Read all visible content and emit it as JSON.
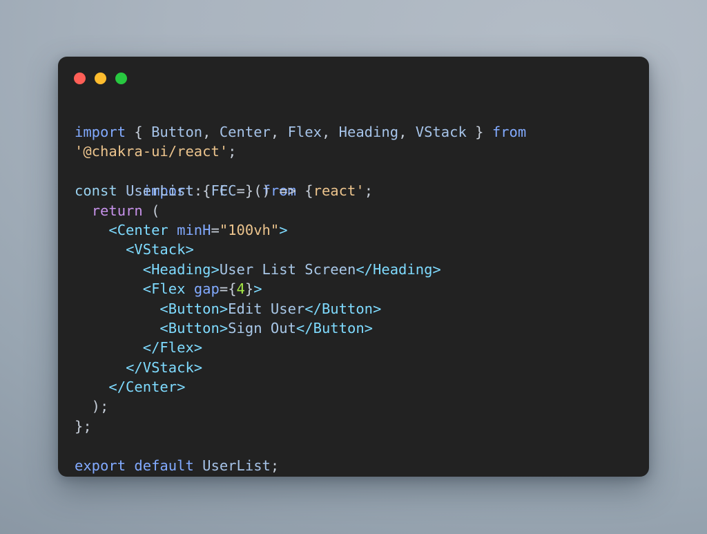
{
  "window": {
    "title_dots": [
      {
        "name": "close-dot",
        "color": "#ff5f57"
      },
      {
        "name": "minimize-dot",
        "color": "#febc2e"
      },
      {
        "name": "maximize-dot",
        "color": "#28c840"
      }
    ]
  },
  "theme": {
    "page_background": "#aab4bf",
    "window_background": "#222222",
    "keyword": "#c792ea",
    "import": "#82aaff",
    "tag": "#7fdbff",
    "string": "#ecc48d",
    "number": "#a5e844",
    "plain": "#d6deeb"
  },
  "code": {
    "language": "tsx",
    "full_source": "import { Button, Center, Flex, Heading, VStack } from '@chakra-ui/react';\nimport { FC } from 'react';\n\nconst UserList: FC = () => {\n  return (\n    <Center minH=\"100vh\">\n      <VStack>\n        <Heading>User List Screen</Heading>\n        <Flex gap={4}>\n          <Button>Edit User</Button>\n          <Button>Sign Out</Button>\n        </Flex>\n      </VStack>\n    </Center>\n  );\n};\n\nexport default UserList;",
    "lines": [
      {
        "id": "line-1",
        "text": "import { Button, Center, Flex, Heading, VStack } from"
      },
      {
        "id": "line-2",
        "text": "import { FC } from 'react';",
        "overlay_text": "'@chakra-ui/react';"
      },
      {
        "id": "line-3",
        "text": ""
      },
      {
        "id": "line-4",
        "text": "const UserList: FC = () => {"
      },
      {
        "id": "line-5",
        "text": "  return ("
      },
      {
        "id": "line-6",
        "text": "    <Center minH=\"100vh\">"
      },
      {
        "id": "line-7",
        "text": "      <VStack>"
      },
      {
        "id": "line-8",
        "text": "        <Heading>User List Screen</Heading>"
      },
      {
        "id": "line-9",
        "text": "        <Flex gap={4}>"
      },
      {
        "id": "line-10",
        "text": "          <Button>Edit User</Button>"
      },
      {
        "id": "line-11",
        "text": "          <Button>Sign Out</Button>"
      },
      {
        "id": "line-12",
        "text": "        </Flex>"
      },
      {
        "id": "line-13",
        "text": "      </VStack>"
      },
      {
        "id": "line-14",
        "text": "    </Center>"
      },
      {
        "id": "line-15",
        "text": "  );"
      },
      {
        "id": "line-16",
        "text": "};"
      },
      {
        "id": "line-17",
        "text": ""
      },
      {
        "id": "line-18",
        "text": "export default UserList;"
      }
    ],
    "tokens": {
      "l1": [
        {
          "t": "import",
          "c": "t-import"
        },
        {
          "t": " { ",
          "c": "t-punct"
        },
        {
          "t": "Button",
          "c": "t-ident"
        },
        {
          "t": ", ",
          "c": "t-punct"
        },
        {
          "t": "Center",
          "c": "t-ident"
        },
        {
          "t": ", ",
          "c": "t-punct"
        },
        {
          "t": "Flex",
          "c": "t-ident"
        },
        {
          "t": ", ",
          "c": "t-punct"
        },
        {
          "t": "Heading",
          "c": "t-ident"
        },
        {
          "t": ", ",
          "c": "t-punct"
        },
        {
          "t": "VStack",
          "c": "t-ident"
        },
        {
          "t": " } ",
          "c": "t-punct"
        },
        {
          "t": "from",
          "c": "t-import"
        }
      ],
      "l2": [
        {
          "t": "import",
          "c": "t-import"
        },
        {
          "t": " { ",
          "c": "t-punct"
        },
        {
          "t": "FC",
          "c": "t-ident"
        },
        {
          "t": " } ",
          "c": "t-punct"
        },
        {
          "t": "from",
          "c": "t-import"
        },
        {
          "t": " ",
          "c": "t-punct"
        },
        {
          "t": "'react'",
          "c": "t-string"
        },
        {
          "t": ";",
          "c": "t-punct"
        }
      ],
      "l2_overlay": [
        {
          "t": "'@chakra-ui/react'",
          "c": "t-string"
        },
        {
          "t": ";",
          "c": "t-punct"
        }
      ],
      "l4": [
        {
          "t": "const",
          "c": "t-const"
        },
        {
          "t": " ",
          "c": "t-punct"
        },
        {
          "t": "UserList",
          "c": "t-ident"
        },
        {
          "t": ": ",
          "c": "t-punct"
        },
        {
          "t": "FC",
          "c": "t-ident"
        },
        {
          "t": " = () => {",
          "c": "t-punct"
        }
      ],
      "l5": [
        {
          "t": "  ",
          "c": "t-punct"
        },
        {
          "t": "return",
          "c": "t-keyword"
        },
        {
          "t": " (",
          "c": "t-punct"
        }
      ],
      "l6": [
        {
          "t": "    ",
          "c": "t-punct"
        },
        {
          "t": "<Center",
          "c": "t-tag"
        },
        {
          "t": " ",
          "c": "t-punct"
        },
        {
          "t": "minH",
          "c": "t-attr"
        },
        {
          "t": "=",
          "c": "t-punct"
        },
        {
          "t": "\"100vh\"",
          "c": "t-string"
        },
        {
          "t": ">",
          "c": "t-tag"
        }
      ],
      "l7": [
        {
          "t": "      ",
          "c": "t-punct"
        },
        {
          "t": "<VStack>",
          "c": "t-tag"
        }
      ],
      "l8": [
        {
          "t": "        ",
          "c": "t-punct"
        },
        {
          "t": "<Heading>",
          "c": "t-tag"
        },
        {
          "t": "User List Screen",
          "c": "t-text"
        },
        {
          "t": "</Heading>",
          "c": "t-tag"
        }
      ],
      "l9": [
        {
          "t": "        ",
          "c": "t-punct"
        },
        {
          "t": "<Flex",
          "c": "t-tag"
        },
        {
          "t": " ",
          "c": "t-punct"
        },
        {
          "t": "gap",
          "c": "t-attr"
        },
        {
          "t": "=",
          "c": "t-punct"
        },
        {
          "t": "{",
          "c": "t-punct"
        },
        {
          "t": "4",
          "c": "t-number"
        },
        {
          "t": "}",
          "c": "t-punct"
        },
        {
          "t": ">",
          "c": "t-tag"
        }
      ],
      "l10": [
        {
          "t": "          ",
          "c": "t-punct"
        },
        {
          "t": "<Button>",
          "c": "t-tag"
        },
        {
          "t": "Edit User",
          "c": "t-text"
        },
        {
          "t": "</Button>",
          "c": "t-tag"
        }
      ],
      "l11": [
        {
          "t": "          ",
          "c": "t-punct"
        },
        {
          "t": "<Button>",
          "c": "t-tag"
        },
        {
          "t": "Sign Out",
          "c": "t-text"
        },
        {
          "t": "</Button>",
          "c": "t-tag"
        }
      ],
      "l12": [
        {
          "t": "        ",
          "c": "t-punct"
        },
        {
          "t": "</Flex>",
          "c": "t-tag"
        }
      ],
      "l13": [
        {
          "t": "      ",
          "c": "t-punct"
        },
        {
          "t": "</VStack>",
          "c": "t-tag"
        }
      ],
      "l14": [
        {
          "t": "    ",
          "c": "t-punct"
        },
        {
          "t": "</Center>",
          "c": "t-tag"
        }
      ],
      "l15": [
        {
          "t": "  );",
          "c": "t-punct"
        }
      ],
      "l16": [
        {
          "t": "};",
          "c": "t-punct"
        }
      ],
      "l18": [
        {
          "t": "export",
          "c": "t-import"
        },
        {
          "t": " ",
          "c": "t-punct"
        },
        {
          "t": "default",
          "c": "t-import"
        },
        {
          "t": " ",
          "c": "t-punct"
        },
        {
          "t": "UserList",
          "c": "t-ident"
        },
        {
          "t": ";",
          "c": "t-punct"
        }
      ]
    }
  }
}
